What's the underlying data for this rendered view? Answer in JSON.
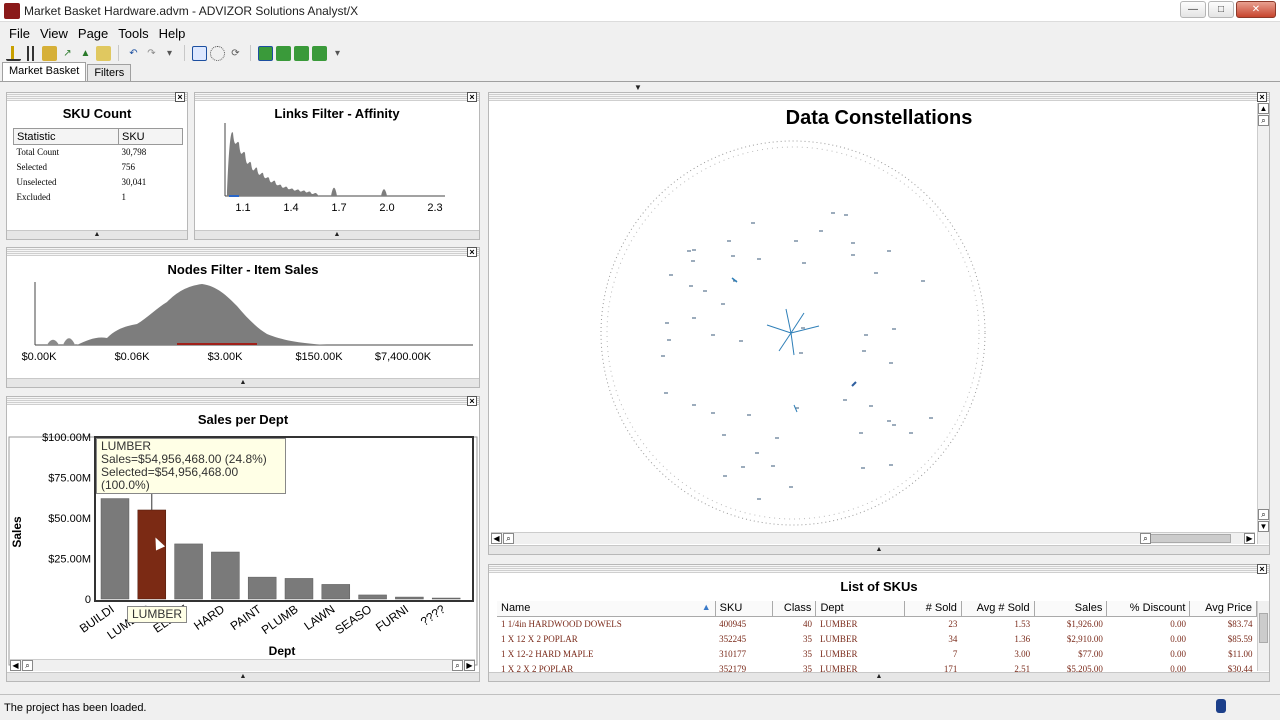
{
  "window": {
    "title": "Market Basket Hardware.advm - ADVIZOR Solutions Analyst/X"
  },
  "menu": [
    "File",
    "View",
    "Page",
    "Tools",
    "Help"
  ],
  "tabs": [
    "Market Basket",
    "Filters"
  ],
  "sku_count": {
    "title": "SKU Count",
    "headers": [
      "Statistic",
      "SKU"
    ],
    "rows": [
      [
        "Total Count",
        "30,798"
      ],
      [
        "Selected",
        "756"
      ],
      [
        "Unselected",
        "30,041"
      ],
      [
        "Excluded",
        "1"
      ]
    ]
  },
  "links_filter": {
    "title": "Links Filter - Affinity",
    "ticks": [
      "1.1",
      "1.4",
      "1.7",
      "2.0",
      "2.3"
    ]
  },
  "nodes_filter": {
    "title": "Nodes Filter - Item Sales",
    "ticks": [
      "$0.00K",
      "$0.06K",
      "$3.00K",
      "$150.00K",
      "$7,400.00K"
    ]
  },
  "sales_per_dept": {
    "title": "Sales per Dept",
    "tooltip": {
      "line1": "LUMBER",
      "line2": "Sales=$54,956,468.00 (24.8%)",
      "line3": "Selected=$54,956,468.00 (100.0%)"
    },
    "hover_label": "LUMBER"
  },
  "chart_data": {
    "type": "bar",
    "title": "Sales per Dept",
    "xlabel": "Dept",
    "ylabel": "Sales",
    "ylim": [
      0,
      100000000
    ],
    "yticks": [
      "$100.00M",
      "$75.00M",
      "$50.00M",
      "$25.00M",
      "0"
    ],
    "categories": [
      "BUILDI",
      "LUMBER",
      "ELECT",
      "HARD",
      "PAINT",
      "PLUMB",
      "LAWN",
      "SEASO",
      "FURNI",
      "????"
    ],
    "values": [
      62000000,
      54956468,
      34000000,
      29000000,
      13500000,
      12700000,
      9000000,
      2500000,
      1200000,
      600000
    ],
    "selected_index": 1,
    "colors": {
      "bar": "#7a7a7a",
      "selected": "#7b2a14"
    }
  },
  "constellations": {
    "title": "Data Constellations"
  },
  "sku_list": {
    "title": "List of SKUs",
    "headers": [
      "Name",
      "SKU",
      "Class",
      "Dept",
      "# Sold",
      "Avg # Sold",
      "Sales",
      "% Discount",
      "Avg Price"
    ],
    "rows": [
      [
        "1 1/4in HARDWOOD DOWELS",
        "400945",
        "40",
        "LUMBER",
        "23",
        "1.53",
        "$1,926.00",
        "0.00",
        "$83.74"
      ],
      [
        "1 X 12 X 2 POPLAR",
        "352245",
        "35",
        "LUMBER",
        "34",
        "1.36",
        "$2,910.00",
        "0.00",
        "$85.59"
      ],
      [
        "1 X 12-2 HARD MAPLE",
        "310177",
        "35",
        "LUMBER",
        "7",
        "3.00",
        "$77.00",
        "0.00",
        "$11.00"
      ],
      [
        "1 X 2 X 2 POPLAR",
        "352179",
        "35",
        "LUMBER",
        "171",
        "2.51",
        "$5,205.00",
        "0.00",
        "$30.44"
      ]
    ]
  },
  "status": {
    "text": "The project has been loaded."
  }
}
